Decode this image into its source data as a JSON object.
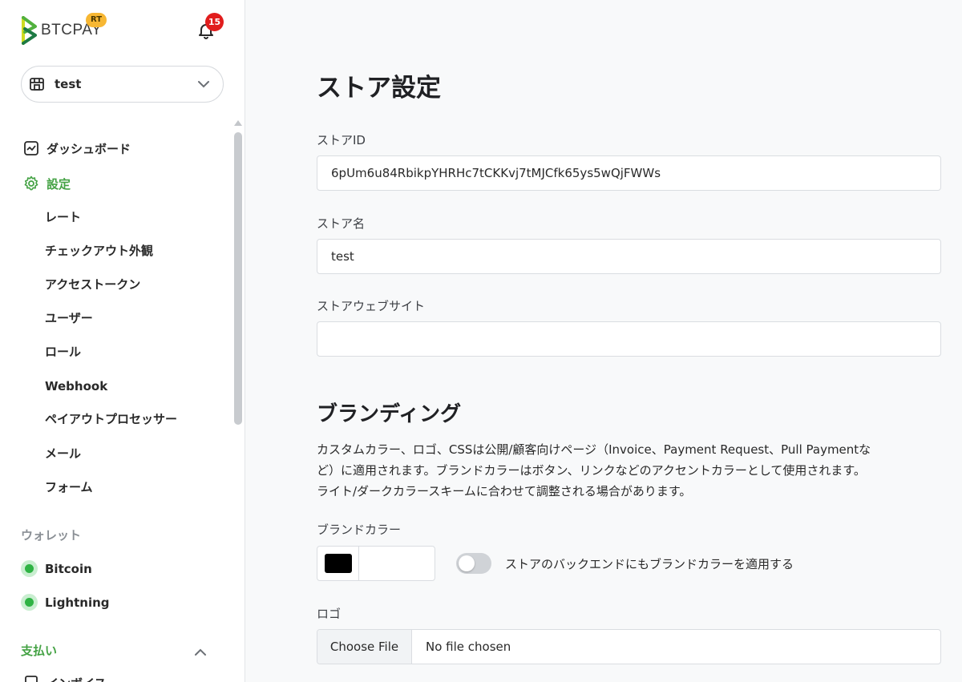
{
  "brand": {
    "logo_text": "BTCPAY",
    "badge": "RT",
    "accent_color": "#44a244"
  },
  "notifications": {
    "count": "15"
  },
  "store_selector": {
    "name": "test"
  },
  "nav": {
    "dashboard": "ダッシュボード",
    "settings": "設定",
    "settings_sub": [
      "レート",
      "チェックアウト外観",
      "アクセストークン",
      "ユーザー",
      "ロール",
      "Webhook",
      "ペイアウトプロセッサー",
      "メール",
      "フォーム"
    ],
    "wallets_label": "ウォレット",
    "wallets": [
      "Bitcoin",
      "Lightning"
    ],
    "payments_label": "支払い",
    "invoices": "インボイス"
  },
  "main": {
    "title": "ストア設定",
    "store_id_label": "ストアID",
    "store_id_value": "6pUm6u84RbikpYHRHc7tCKKvj7tMJCfk65ys5wQjFWWs",
    "store_name_label": "ストア名",
    "store_name_value": "test",
    "store_website_label": "ストアウェブサイト",
    "store_website_value": "",
    "branding_title": "ブランディング",
    "branding_desc_1": "カスタムカラー、ロゴ、CSSは公開/顧客向けページ（Invoice、Payment Request、Pull Paymentな",
    "branding_desc_2": "ど）に適用されます。ブランドカラーはボタン、リンクなどのアクセントカラーとして使用されます。",
    "branding_desc_3": "ライト/ダークカラースキームに合わせて調整される場合があります。",
    "brand_color_label": "ブランドカラー",
    "brand_color_value": "#000000",
    "apply_backend_label": "ストアのバックエンドにもブランドカラーを適用する",
    "apply_backend_on": false,
    "logo_label": "ロゴ",
    "choose_file": "Choose File",
    "no_file": "No file chosen"
  }
}
